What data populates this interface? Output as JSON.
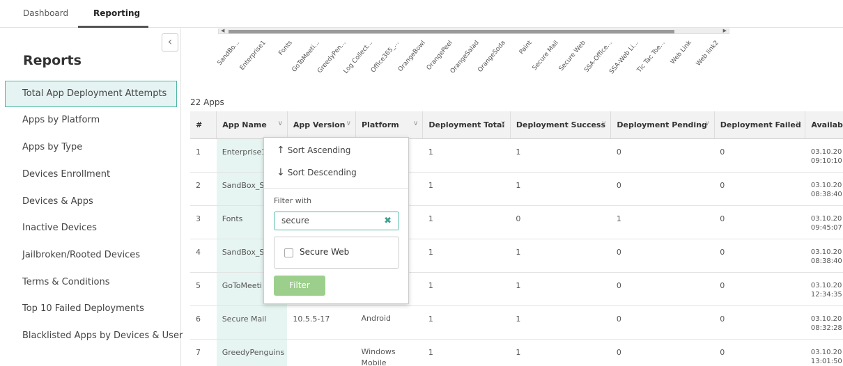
{
  "topbar": {
    "tabs": [
      "Dashboard",
      "Reporting"
    ]
  },
  "sidebar": {
    "title": "Reports",
    "items": [
      "Total App Deployment Attempts",
      "Apps by Platform",
      "Apps by Type",
      "Devices Enrollment",
      "Devices & Apps",
      "Inactive Devices",
      "Jailbroken/Rooted Devices",
      "Terms & Conditions",
      "Top 10 Failed Deployments",
      "Blacklisted Apps by Devices & User"
    ],
    "active_index": 0
  },
  "chart_axis_labels": [
    "SandBo...",
    "Enterprise1",
    "Fonts",
    "GoToMeeti...",
    "GreedyPen...",
    "Log Collect...",
    "Office365_...",
    "OrangeBowl",
    "OrangePeel",
    "OrangeSalad",
    "OrangeSoda",
    "Paint",
    "Secure Mail",
    "Secure Web",
    "SSA-Office...",
    "SSA-Web Li...",
    "Tic Tac Toe...",
    "Web Link",
    "Web link2"
  ],
  "apps_count": "22 Apps",
  "table": {
    "columns": [
      "#",
      "App Name",
      "App Version",
      "Platform",
      "Deployment Total",
      "Deployment Success",
      "Deployment Pending",
      "Deployment Failed",
      "Availab"
    ],
    "rows": [
      {
        "n": "1",
        "app": "Enterprise1",
        "ver": "",
        "plat": "",
        "total": "1",
        "success": "1",
        "pending": "0",
        "failed": "0",
        "avail1": "03.10.20",
        "avail2": "09:10:10"
      },
      {
        "n": "2",
        "app": "SandBox_S",
        "ver": "",
        "plat": "",
        "total": "1",
        "success": "1",
        "pending": "0",
        "failed": "0",
        "avail1": "03.10.20",
        "avail2": "08:38:40"
      },
      {
        "n": "3",
        "app": "Fonts",
        "ver": "",
        "plat": "",
        "total": "1",
        "success": "0",
        "pending": "1",
        "failed": "0",
        "avail1": "03.10.20",
        "avail2": "09:45:07"
      },
      {
        "n": "4",
        "app": "SandBox_S",
        "ver": "",
        "plat": "",
        "total": "1",
        "success": "1",
        "pending": "0",
        "failed": "0",
        "avail1": "03.10.20",
        "avail2": "08:38:40"
      },
      {
        "n": "5",
        "app": "GoToMeeti",
        "ver": "",
        "plat": "",
        "total": "1",
        "success": "1",
        "pending": "0",
        "failed": "0",
        "avail1": "03.10.20",
        "avail2": "12:34:35"
      },
      {
        "n": "6",
        "app": "Secure Mail",
        "ver": "10.5.5-17",
        "plat": "Android",
        "total": "1",
        "success": "1",
        "pending": "0",
        "failed": "0",
        "avail1": "03.10.20",
        "avail2": "08:32:28"
      },
      {
        "n": "7",
        "app": "GreedyPenguins",
        "ver": "",
        "plat": "Windows Mobile",
        "total": "1",
        "success": "1",
        "pending": "0",
        "failed": "0",
        "avail1": "03.10.20",
        "avail2": "13:01:50"
      }
    ]
  },
  "popover": {
    "sort_asc": "Sort Ascending",
    "sort_desc": "Sort Descending",
    "filter_label": "Filter with",
    "filter_value": "secure",
    "option": "Secure Web",
    "filter_button": "Filter"
  },
  "colors": {
    "accent": "#4fb7a6",
    "highlight": "#e7f5f2",
    "filter_button": "#9ccf8c"
  }
}
